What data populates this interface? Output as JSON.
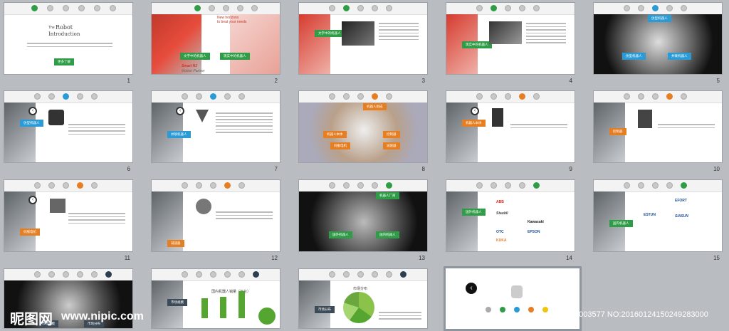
{
  "slide_numbers": [
    "1",
    "2",
    "3",
    "4",
    "5",
    "6",
    "7",
    "8",
    "9",
    "10",
    "11",
    "12",
    "13",
    "14",
    "15"
  ],
  "slide1": {
    "title_small": "The",
    "title": "Robot",
    "title2": "Introduction",
    "button": "更多了解"
  },
  "slide2": {
    "tag1": "文字中的机器人",
    "tag2": "现实中的机器人",
    "headline": "New horizons",
    "subline": "to beat your needs",
    "brand1": "Smart NJ",
    "brand2": "Motion Partner"
  },
  "slide3": {
    "tag": "文字中的机器人"
  },
  "slide4": {
    "tag": "现实中的机器人"
  },
  "slide5": {
    "top_tag": "仿型机器人",
    "tag1": "仿型机器人",
    "tag2": "并联机器人"
  },
  "slide6": {
    "tag": "仿型机器人"
  },
  "slide7": {
    "tag": "并联机器人"
  },
  "slide8": {
    "top_tag": "机器人组成",
    "tag1": "机器人本体",
    "tag2": "控制器",
    "tag3": "伺服电机",
    "tag4": "减速器"
  },
  "slide9": {
    "tag": "机器人本体"
  },
  "slide10": {
    "tag": "控制器"
  },
  "slide11": {
    "tag": "伺服电机"
  },
  "slide12": {
    "tag": "减速器"
  },
  "slide13": {
    "top_tag": "机器人厂商",
    "tag1": "国外机器人",
    "tag2": "国内机器人"
  },
  "slide14": {
    "tag": "国外机器人",
    "brands": [
      "ABB",
      "Staubli",
      "Kawasaki",
      "KUKA",
      "EPSON",
      "OTC"
    ]
  },
  "slide15": {
    "tag": "国内机器人",
    "brands": [
      "EFORT",
      "ESTUN",
      "SIASUN"
    ]
  },
  "slide16": {
    "tag1": "市场规模",
    "tag2": "市场分布"
  },
  "slide17": {
    "title": "国内机器人销量（万台）"
  },
  "slide18": {
    "title": "市场分布"
  },
  "watermark": {
    "logo": "昵图网",
    "url": "www.nipic.com",
    "id": "ID:5003577 NO:20160124150249283000"
  },
  "colors": {
    "green": "#2f9d47",
    "blue": "#2b9bd6",
    "orange": "#e67e22",
    "dark": "#3d4a58"
  }
}
